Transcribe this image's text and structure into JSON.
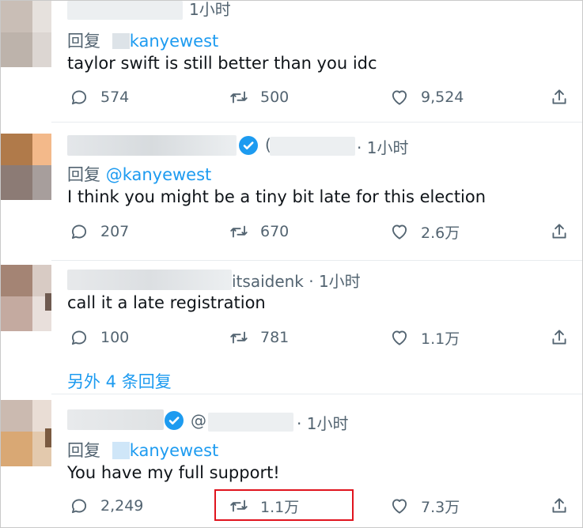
{
  "tweets": [
    {
      "time": "1小时",
      "reply_prefix": "回复",
      "mention": "kanyewest",
      "text": "taylor swift is still better than you idc",
      "stats": {
        "replies": "574",
        "retweets": "500",
        "likes": "9,524"
      }
    },
    {
      "time": "· 1小时",
      "verified": true,
      "reply_prefix": "回复",
      "mention": "@kanyewest",
      "text": "I think you might be a tiny bit late for this election",
      "stats": {
        "replies": "207",
        "retweets": "670",
        "likes": "2.6万"
      }
    },
    {
      "handle_fragment": "itsaidenk · 1小时",
      "text": "call it a late registration",
      "stats": {
        "replies": "100",
        "retweets": "781",
        "likes": "1.1万"
      }
    },
    {
      "time": "· 1小时",
      "verified": true,
      "handle_prefix": "@",
      "reply_prefix": "回复",
      "mention": "kanyewest",
      "text": "You have my full support!",
      "stats": {
        "replies": "2,249",
        "retweets": "1.1万",
        "likes": "7.3万"
      }
    }
  ],
  "more_replies": "另外 4 条回复",
  "icons": [
    "reply-icon",
    "retweet-icon",
    "like-icon",
    "share-icon",
    "verified-badge-icon"
  ],
  "colors": {
    "accent": "#1d9bf0",
    "muted": "#536471",
    "highlight": "#e0141e"
  }
}
